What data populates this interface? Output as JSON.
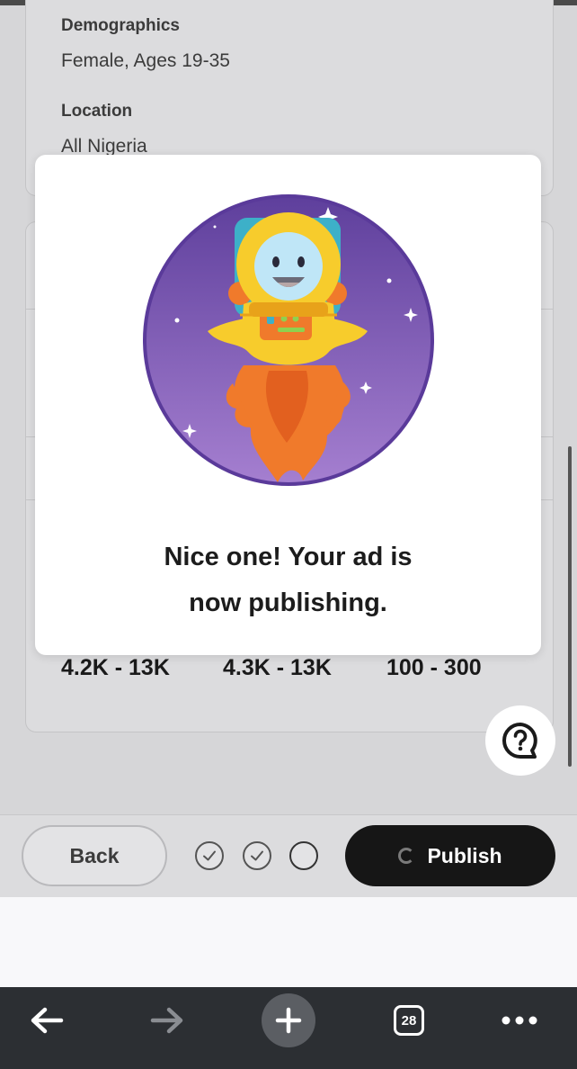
{
  "targeting": {
    "demographics_label": "Demographics",
    "demographics_value": "Female, Ages 19-35",
    "location_label": "Location",
    "location_value": "All Nigeria"
  },
  "metrics": [
    "4.2K - 13K",
    "4.3K - 13K",
    "100 - 300"
  ],
  "modal": {
    "line1": "Nice one! Your ad is",
    "line2": "now publishing."
  },
  "actions": {
    "back_label": "Back",
    "publish_label": "Publish",
    "steps": [
      "complete",
      "complete",
      "incomplete"
    ]
  },
  "browser": {
    "tab_count": "28"
  },
  "colors": {
    "publish_button": "#161616",
    "modal_background": "#ffffff",
    "illustration_purple": "#6b4aa8",
    "rocket_yellow": "#f7cc2c",
    "flame_orange": "#f07a2b"
  }
}
